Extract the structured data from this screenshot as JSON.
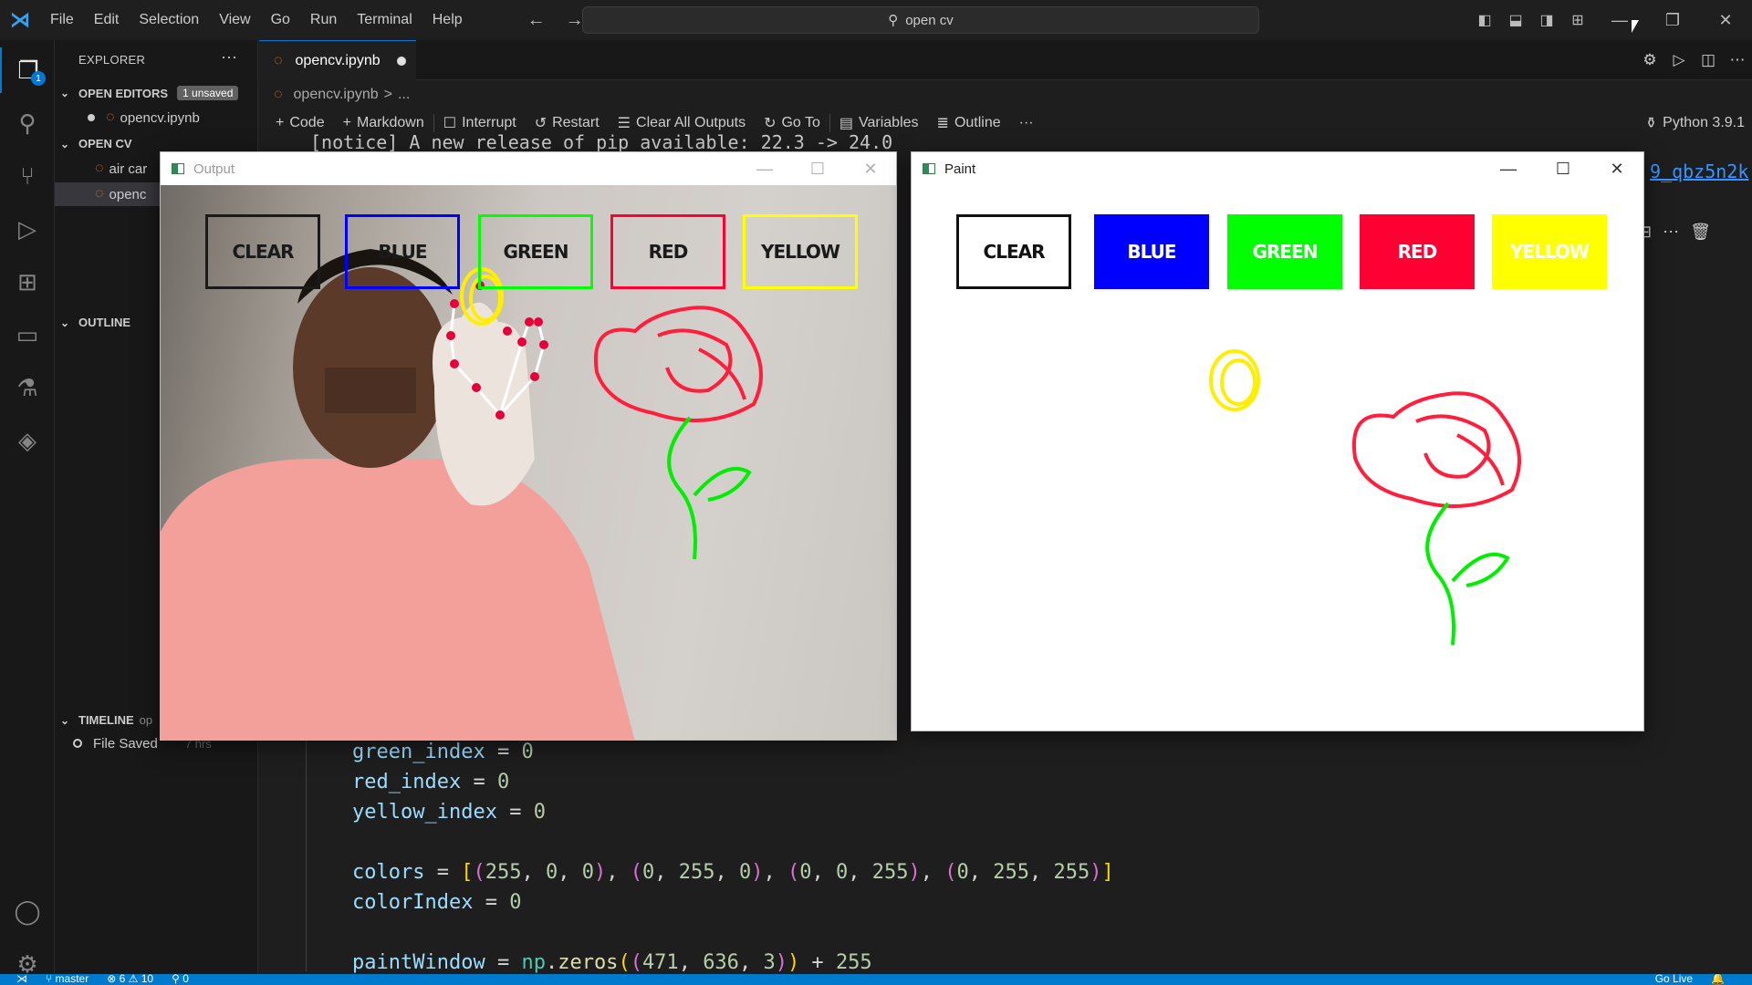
{
  "titlebar": {
    "menu": [
      "File",
      "Edit",
      "Selection",
      "View",
      "Go",
      "Run",
      "Terminal",
      "Help"
    ],
    "search_text": "open cv"
  },
  "activity": {
    "explorer_badge": "1"
  },
  "sidebar": {
    "title": "EXPLORER",
    "more": "···",
    "open_editors_label": "OPEN EDITORS",
    "unsaved_badge": "1 unsaved",
    "open_editor_file": "opencv.ipynb",
    "folder_label": "OPEN CV",
    "files": [
      "air car",
      "openc"
    ],
    "outline_label": "OUTLINE",
    "timeline_label": "TIMELINE",
    "timeline_suffix": "op",
    "timeline_entry": "File Saved",
    "timeline_time": "7 hrs"
  },
  "tab": {
    "label": "opencv.ipynb"
  },
  "breadcrumb": {
    "file": "opencv.ipynb",
    "sep": ">",
    "rest": "..."
  },
  "notebook_toolbar": {
    "code": "Code",
    "markdown": "Markdown",
    "interrupt": "Interrupt",
    "restart": "Restart",
    "clear": "Clear All Outputs",
    "goto": "Go To",
    "variables": "Variables",
    "outline": "Outline",
    "more": "···",
    "kernel": "Python 3.9.1"
  },
  "notebook_output": {
    "notice": "[notice] A new release of pip available: 22.3 -> 24.0",
    "link_fragment": "9_qbz5n2k"
  },
  "code_lines": {
    "l1_var": "green_index",
    "l1_val": "0",
    "l2_var": "red_index",
    "l2_val": "0",
    "l3_var": "yellow_index",
    "l3_val": "0",
    "l5_var": "colors",
    "l5_t1": [
      "255",
      "0",
      "0"
    ],
    "l5_t2": [
      "0",
      "255",
      "0"
    ],
    "l5_t3": [
      "0",
      "0",
      "255"
    ],
    "l5_t4": [
      "0",
      "255",
      "255"
    ],
    "l6_var": "colorIndex",
    "l6_val": "0",
    "l8_var": "paintWindow",
    "l8_mod": "np",
    "l8_fn": "zeros",
    "l8_args": [
      "471",
      "636",
      "3"
    ],
    "l8_add": "255"
  },
  "statusbar": {
    "branch": "master",
    "problems": "⊗ 6 ⚠ 10",
    "ports": "0",
    "golive": "Go Live"
  },
  "output_window": {
    "title": "Output",
    "buttons": [
      "CLEAR",
      "BLUE",
      "GREEN",
      "RED",
      "YELLOW"
    ]
  },
  "paint_window": {
    "title": "Paint",
    "buttons": [
      "CLEAR",
      "BLUE",
      "GREEN",
      "RED",
      "YELLOW"
    ]
  },
  "colors": {
    "blue": "#0000ff",
    "green": "#00ff00",
    "red": "#ff0033",
    "yellow": "#ffff00",
    "accent": "#007acc"
  }
}
